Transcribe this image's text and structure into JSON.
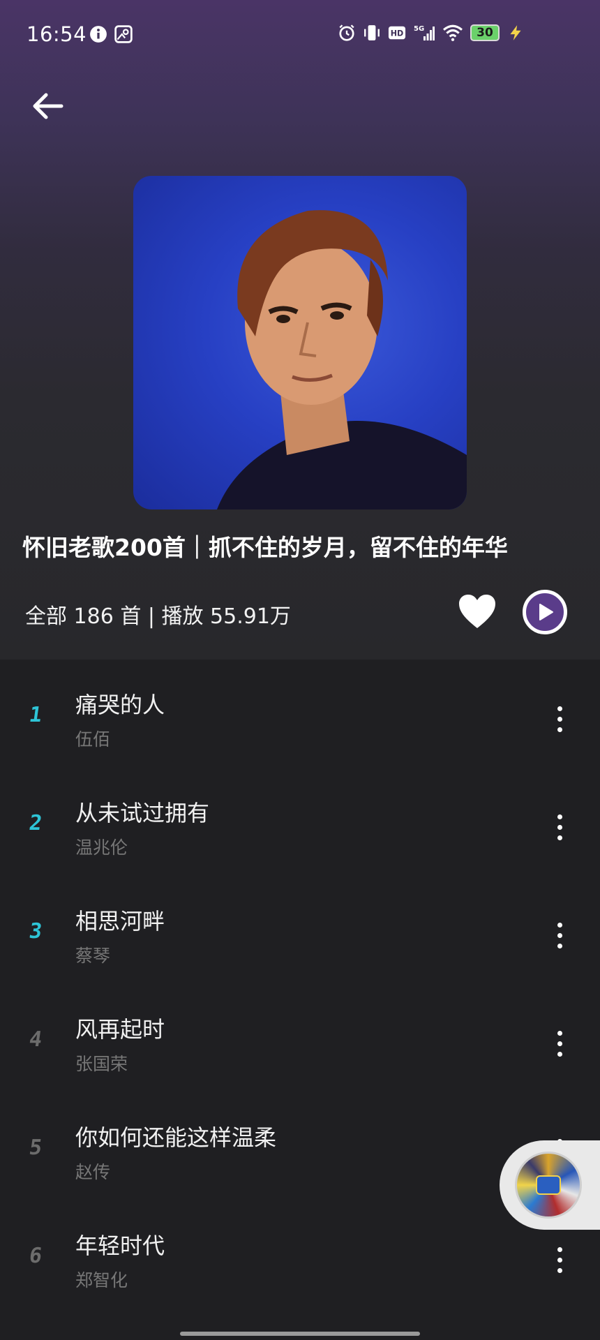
{
  "status_bar": {
    "time": "16:54",
    "network": "5G",
    "hd_label": "HD",
    "battery": "30",
    "icons": [
      "info-icon",
      "gallery-icon",
      "alarm-icon",
      "vibrate-icon",
      "hd-icon",
      "signal-icon",
      "wifi-icon",
      "battery-icon",
      "charging-icon"
    ]
  },
  "header": {
    "back_icon": "arrow-left-icon"
  },
  "playlist": {
    "title": "怀旧老歌200首｜抓不住的岁月，留不住的年华",
    "stats": "全部 186 首 | 播放 55.91万",
    "like_icon": "heart-icon",
    "play_icon": "play-circle-icon"
  },
  "songs": [
    {
      "index": "1",
      "title": "痛哭的人",
      "artist": "伍佰",
      "index_color": "#2ec4d6"
    },
    {
      "index": "2",
      "title": "从未试过拥有",
      "artist": "温兆伦",
      "index_color": "#2ec4d6"
    },
    {
      "index": "3",
      "title": "相思河畔",
      "artist": "蔡琴",
      "index_color": "#2ec4d6"
    },
    {
      "index": "4",
      "title": "风再起时",
      "artist": "张国荣",
      "index_color": "#6c6c6c"
    },
    {
      "index": "5",
      "title": "你如何还能这样温柔",
      "artist": "赵传",
      "index_color": "#6c6c6c"
    },
    {
      "index": "6",
      "title": "年轻时代",
      "artist": "郑智化",
      "index_color": "#6c6c6c"
    }
  ],
  "colors": {
    "accent": "#5a3c8a",
    "header_gradient_top": "#4a3466",
    "background": "#1f1f22"
  }
}
